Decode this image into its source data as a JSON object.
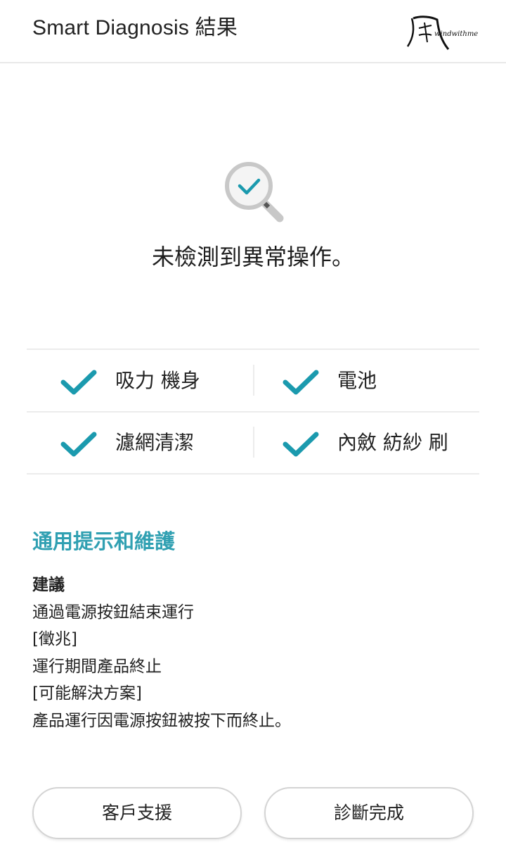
{
  "header": {
    "title": "Smart Diagnosis 結果"
  },
  "watermark": {
    "glyph": "風",
    "text": "windwithme"
  },
  "result": {
    "message": "未檢測到異常操作。"
  },
  "checks": [
    {
      "label": "吸力 機身",
      "status": "ok"
    },
    {
      "label": "電池",
      "status": "ok"
    },
    {
      "label": "濾網清潔",
      "status": "ok"
    },
    {
      "label": "內斂 紡紗 刷",
      "status": "ok"
    }
  ],
  "tips": {
    "title": "通用提示和維護",
    "heading": "建議",
    "lines": [
      "通過電源按鈕結束運行",
      "[徵兆]",
      "運行期間產品終止",
      "[可能解決方案]",
      "產品運行因電源按鈕被按下而終止。"
    ]
  },
  "buttons": {
    "support": "客戶支援",
    "done": "診斷完成"
  },
  "colors": {
    "accent": "#30a0b2",
    "check": "#1b9aae",
    "divider": "#ececec",
    "magnifier": "#c8c8c8"
  },
  "icons": {
    "result": "magnifier-check-icon",
    "item": "checkmark-icon"
  }
}
